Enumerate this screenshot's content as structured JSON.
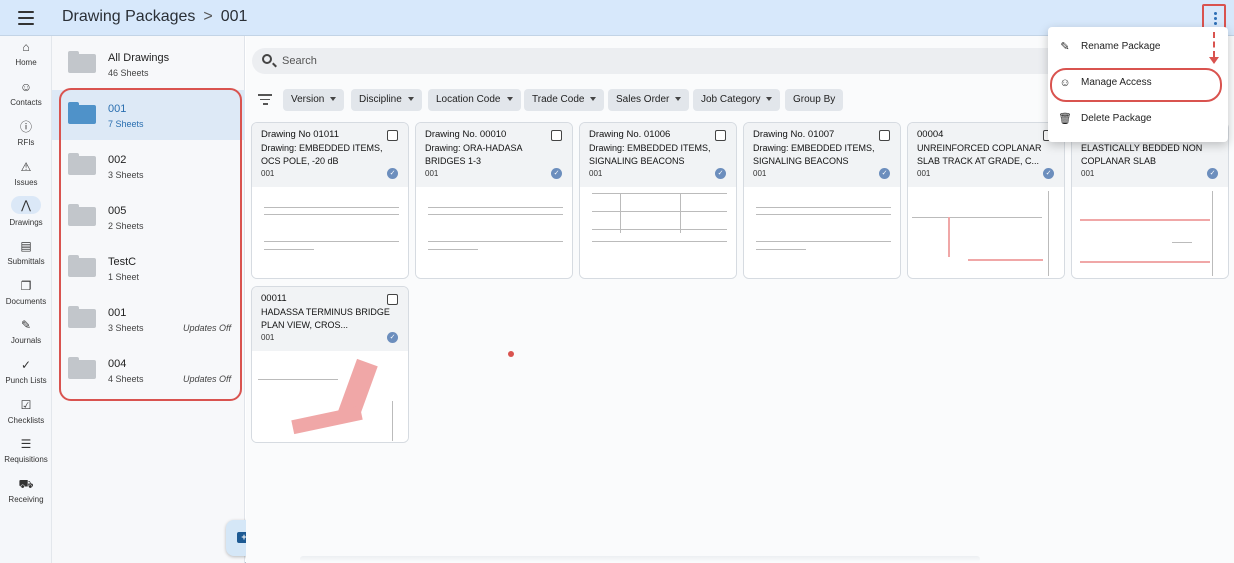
{
  "header": {
    "breadcrumb_root": "Drawing Packages",
    "breadcrumb_separator": ">",
    "breadcrumb_current": "001"
  },
  "rail": {
    "items": [
      {
        "label": "Home",
        "icon": "home-icon"
      },
      {
        "label": "Contacts",
        "icon": "person-icon"
      },
      {
        "label": "RFIs",
        "icon": "info-icon"
      },
      {
        "label": "Issues",
        "icon": "warning-icon"
      },
      {
        "label": "Drawings",
        "icon": "compass-icon"
      },
      {
        "label": "Submittals",
        "icon": "document-icon"
      },
      {
        "label": "Documents",
        "icon": "stack-icon"
      },
      {
        "label": "Journals",
        "icon": "edit-box-icon"
      },
      {
        "label": "Punch Lists",
        "icon": "stamp-icon"
      },
      {
        "label": "Checklists",
        "icon": "checklist-icon"
      },
      {
        "label": "Requisitions",
        "icon": "list-box-icon"
      },
      {
        "label": "Receiving",
        "icon": "truck-icon"
      }
    ]
  },
  "folders": [
    {
      "name": "All Drawings",
      "count": "46 Sheets",
      "note": ""
    },
    {
      "name": "001",
      "count": "7 Sheets",
      "note": ""
    },
    {
      "name": "002",
      "count": "3 Sheets",
      "note": ""
    },
    {
      "name": "005",
      "count": "2 Sheets",
      "note": ""
    },
    {
      "name": "TestC",
      "count": "1 Sheet",
      "note": ""
    },
    {
      "name": "001",
      "count": "3 Sheets",
      "note": "Updates Off"
    },
    {
      "name": "004",
      "count": "4 Sheets",
      "note": "Updates Off"
    }
  ],
  "search": {
    "placeholder": "Search"
  },
  "filters": [
    "Version",
    "Discipline",
    "Location Code",
    "Trade Code",
    "Sales Order",
    "Job Category"
  ],
  "group_by": "Group By",
  "cards": [
    {
      "number": "Drawing No 01011",
      "desc": "Drawing: EMBEDDED ITEMS, OCS POLE, -20 dB",
      "package": "001"
    },
    {
      "number": "Drawing No. 00010",
      "desc": "Drawing: ORA-HADASA BRIDGES 1-3",
      "package": "001"
    },
    {
      "number": "Drawing No. 01006",
      "desc": "Drawing: EMBEDDED ITEMS, SIGNALING BEACONS",
      "package": "001"
    },
    {
      "number": "Drawing No. 01007",
      "desc": "Drawing: EMBEDDED ITEMS, SIGNALING BEACONS",
      "package": "001"
    },
    {
      "number": "00004",
      "desc": "UNREINFORCED COPLANAR SLAB TRACK AT GRADE, C...",
      "package": "001"
    },
    {
      "number": "",
      "desc": "ELASTICALLY BEDDED NON COPLANAR SLAB",
      "package": "001"
    },
    {
      "number": "00011",
      "desc": "HADASSA TERMINUS BRIDGE PLAN VIEW, CROS...",
      "package": "001"
    }
  ],
  "menu": {
    "items": [
      {
        "label": "Rename Package",
        "icon": "pencil-icon"
      },
      {
        "label": "Manage Access",
        "icon": "person-add-icon"
      },
      {
        "label": "Delete Package",
        "icon": "trash-icon"
      }
    ]
  },
  "colors": {
    "header_bg": "#d7e8fb",
    "selected_folder": "#4f92c9",
    "highlight": "#d9534f"
  }
}
